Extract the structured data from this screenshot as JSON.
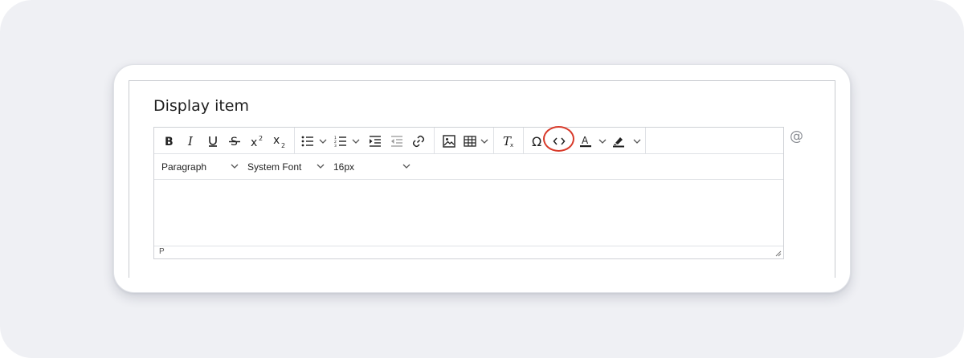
{
  "field": {
    "label": "Display item"
  },
  "toolbar": {
    "buttons": [
      {
        "name": "bold",
        "icon": "bold-icon"
      },
      {
        "name": "italic",
        "icon": "italic-icon"
      },
      {
        "name": "underline",
        "icon": "underline-icon"
      },
      {
        "name": "strikethrough",
        "icon": "strikethrough-icon"
      },
      {
        "name": "superscript",
        "icon": "superscript-icon"
      },
      {
        "name": "subscript",
        "icon": "subscript-icon"
      },
      {
        "name": "bullet-list",
        "icon": "bullet-list-icon"
      },
      {
        "name": "numbered-list",
        "icon": "numbered-list-icon"
      },
      {
        "name": "indent",
        "icon": "indent-icon"
      },
      {
        "name": "outdent",
        "icon": "outdent-icon"
      },
      {
        "name": "link",
        "icon": "link-icon"
      },
      {
        "name": "image",
        "icon": "image-icon"
      },
      {
        "name": "table",
        "icon": "table-icon"
      },
      {
        "name": "clear-formatting",
        "icon": "clear-formatting-icon"
      },
      {
        "name": "special-character",
        "icon": "omega-icon"
      },
      {
        "name": "source-code",
        "icon": "code-icon",
        "highlighted": true
      },
      {
        "name": "text-color",
        "icon": "text-color-icon"
      },
      {
        "name": "highlight-color",
        "icon": "highlighter-icon"
      }
    ]
  },
  "format": {
    "block_format": "Paragraph",
    "font_family": "System Font",
    "font_size": "16px"
  },
  "status": {
    "path": "P"
  },
  "mention": {
    "icon": "at-sign-icon",
    "glyph": "@"
  },
  "colors": {
    "highlight_ring": "#d83a2a",
    "backdrop": "#eff0f4",
    "text_color_bar": "#222222"
  }
}
